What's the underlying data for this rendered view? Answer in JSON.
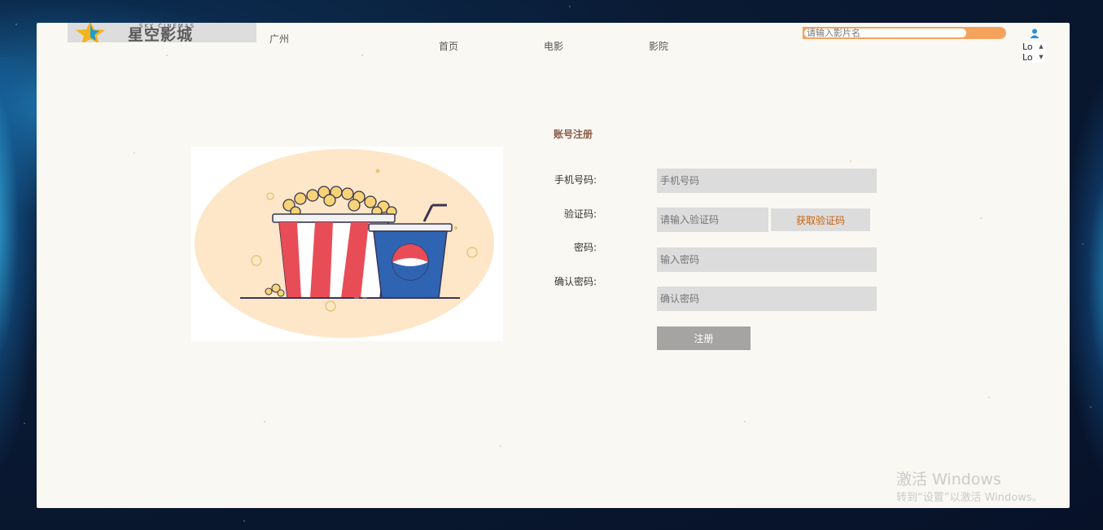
{
  "header": {
    "logo_sub": "SKY CINEMAS",
    "logo_name": "星空影城",
    "city": "广州",
    "nav": [
      "首页",
      "电影",
      "影院"
    ],
    "search_placeholder": "请输入影片名",
    "lang_options": [
      "Lo",
      "Lo"
    ]
  },
  "form": {
    "title": "账号注册",
    "phone_label": "手机号码:",
    "phone_placeholder": "手机号码",
    "code_label": "验证码:",
    "code_placeholder": "请输入验证码",
    "get_code_label": "获取验证码",
    "password_label": "密码:",
    "password_placeholder": "输入密码",
    "confirm_label": "确认密码:",
    "confirm_placeholder": "确认密码",
    "submit_label": "注册"
  },
  "watermark": {
    "line1": "激活 Windows",
    "line2": "转到“设置”以激活 Windows。"
  },
  "colors": {
    "accent_orange": "#f4a25c",
    "code_text": "#c8620c",
    "title_brown": "#8a5a44",
    "submit_gray": "#a6a3a3"
  }
}
